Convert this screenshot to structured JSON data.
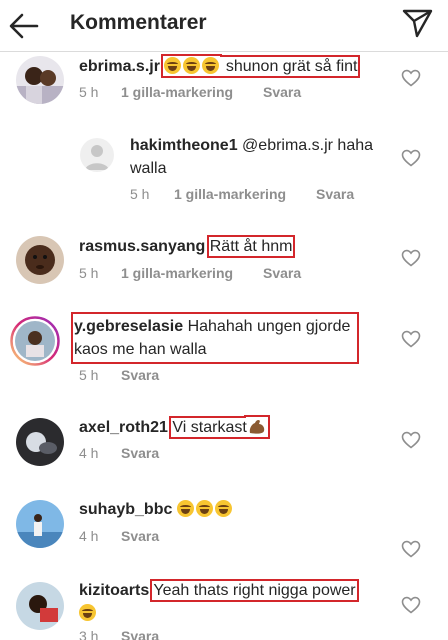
{
  "header": {
    "title": "Kommentarer",
    "back_icon": "arrow-left-icon",
    "send_icon": "paper-plane-icon"
  },
  "comments": [
    {
      "username": "ebrima.s.jr",
      "text": "shunon grät så fint",
      "emoji_prefix": "😂😂😂",
      "time": "5 h",
      "likes": "1 gilla-markering",
      "reply": "Svara"
    },
    {
      "username": "hakimtheone1",
      "text_line1": "@ebrima.s.jr haha",
      "text_line2": "walla",
      "time": "5 h",
      "likes": "1 gilla-markering",
      "reply": "Svara"
    },
    {
      "username": "rasmus.sanyang",
      "text": "Rätt åt hnm",
      "time": "5 h",
      "likes": "1 gilla-markering",
      "reply": "Svara"
    },
    {
      "username": "y.gebreselasie",
      "text_line1": "Hahahah ungen gjorde",
      "text_line2": "kaos me han walla",
      "time": "5 h",
      "reply": "Svara"
    },
    {
      "username": "axel_roth21",
      "text": "Vi starkast",
      "emoji_suffix": "💪🏾",
      "time": "4 h",
      "reply": "Svara"
    },
    {
      "username": "suhayb_bbc",
      "emoji": "😂😂😂",
      "time": "4 h",
      "reply": "Svara"
    },
    {
      "username": "kizitoarts",
      "text": "Yeah thats right nigga power",
      "emoji_line2": "😂",
      "time": "3 h",
      "reply": "Svara"
    }
  ],
  "colors": {
    "highlight": "#d3262b",
    "meta": "#8e8e8e",
    "text": "#262626",
    "story_ring": "#d6249f"
  }
}
